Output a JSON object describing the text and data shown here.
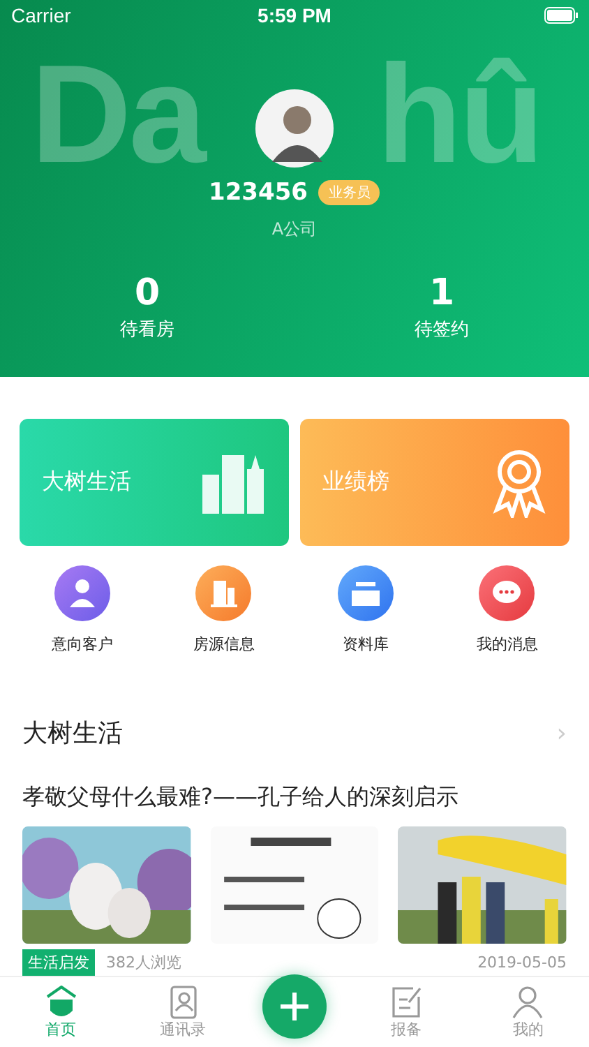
{
  "status_bar": {
    "carrier": "Carrier",
    "time": "5:59 PM"
  },
  "profile": {
    "backdrop_text": [
      "Da",
      "hû"
    ],
    "user_id": "123456",
    "role": "业务员",
    "company": "A公司"
  },
  "stats": [
    {
      "value": "0",
      "label": "待看房"
    },
    {
      "value": "1",
      "label": "待签约"
    }
  ],
  "feature_cards": [
    {
      "kind": "life",
      "label": "大树生活"
    },
    {
      "kind": "ranking",
      "label": "业绩榜"
    }
  ],
  "shortcuts": [
    {
      "kind": "customer",
      "label": "意向客户"
    },
    {
      "kind": "property",
      "label": "房源信息"
    },
    {
      "kind": "library",
      "label": "资料库"
    },
    {
      "kind": "message",
      "label": "我的消息"
    }
  ],
  "section": {
    "title": "大树生活",
    "chevron": "›"
  },
  "article": {
    "title": "孝敬父母什么最难?——孔子给人的深刻启示",
    "tag": "生活启发",
    "views": "382人浏览",
    "date": "2019-05-05"
  },
  "tab_bar": [
    {
      "kind": "home",
      "label": "首页",
      "selected": true
    },
    {
      "kind": "contacts",
      "label": "通讯录",
      "selected": false
    },
    {
      "kind": "add"
    },
    {
      "kind": "report",
      "label": "报备",
      "selected": false
    },
    {
      "kind": "me",
      "label": "我的",
      "selected": false
    }
  ]
}
